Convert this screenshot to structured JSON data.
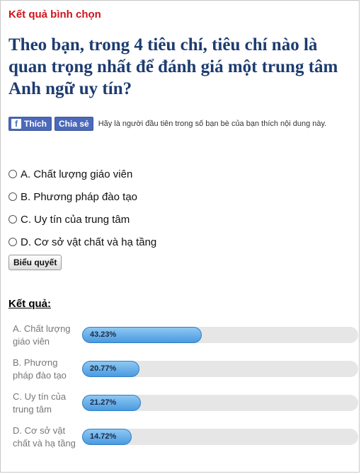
{
  "header": {
    "title": "Kết quả bình chọn"
  },
  "question": "Theo bạn, trong 4 tiêu chí, tiêu chí nào là quan trọng nhất để đánh giá một trung tâm Anh ngữ uy tín?",
  "social": {
    "like_label": "Thích",
    "share_label": "Chia sẻ",
    "logo_glyph": "f",
    "prompt": "Hãy là người đầu tiên trong số bạn bè của bạn thích nội dung này.",
    "brand_color": "#4c69ba"
  },
  "options": [
    {
      "label": "A. Chất lượng giáo viên",
      "selected": false
    },
    {
      "label": "B. Phương pháp đào tạo",
      "selected": false
    },
    {
      "label": "C. Uy tín của trung tâm",
      "selected": false
    },
    {
      "label": "D. Cơ sở vật chất và hạ tầng",
      "selected": false
    }
  ],
  "vote_button_label": "Biểu quyết",
  "results": {
    "title": "Kết quả:",
    "items": [
      {
        "label": "A. Chất lượng giáo viên",
        "percent_text": "43.23%",
        "value": 43.23
      },
      {
        "label": "B. Phương pháp đào tạo",
        "percent_text": "20.77%",
        "value": 20.77
      },
      {
        "label": "C. Uy tín của trung tâm",
        "percent_text": "21.27%",
        "value": 21.27
      },
      {
        "label": "D. Cơ sở vật chất và hạ tầng",
        "percent_text": "14.72%",
        "value": 14.72
      }
    ]
  },
  "colors": {
    "header": "#d0121b",
    "question": "#1d3c70",
    "bar_fill": "#4a9ae0",
    "bar_track": "#e6e6e6"
  }
}
